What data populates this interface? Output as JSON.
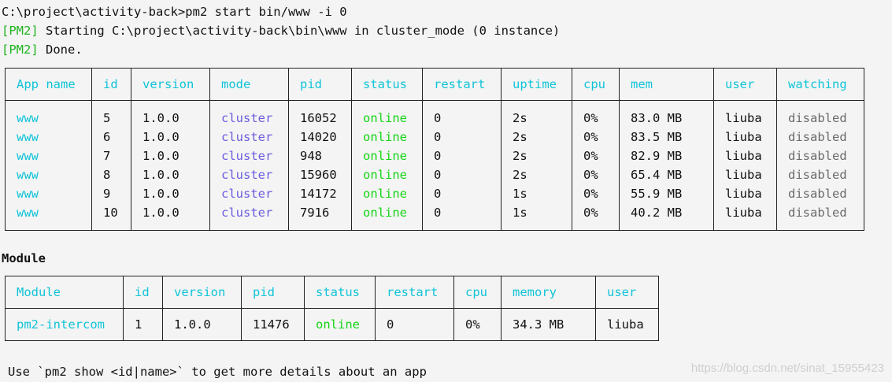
{
  "command": {
    "prompt": "C:\\project\\activity-back>",
    "text": "pm2 start bin/www -i 0"
  },
  "log": [
    {
      "tag": "[PM2]",
      "text": " Starting C:\\project\\activity-back\\bin\\www in cluster_mode (0 instance)"
    },
    {
      "tag": "[PM2]",
      "text": " Done."
    }
  ],
  "apps_table": {
    "headers": [
      "App name",
      "id",
      "version",
      "mode",
      "pid",
      "status",
      "restart",
      "uptime",
      "cpu",
      "mem",
      "user",
      "watching"
    ],
    "rows": [
      {
        "name": "www",
        "id": "5",
        "version": "1.0.0",
        "mode": "cluster",
        "pid": "16052",
        "status": "online",
        "restart": "0",
        "uptime": "2s",
        "cpu": "0%",
        "mem": "83.0 MB",
        "user": "liuba",
        "watching": "disabled"
      },
      {
        "name": "www",
        "id": "6",
        "version": "1.0.0",
        "mode": "cluster",
        "pid": "14020",
        "status": "online",
        "restart": "0",
        "uptime": "2s",
        "cpu": "0%",
        "mem": "83.5 MB",
        "user": "liuba",
        "watching": "disabled"
      },
      {
        "name": "www",
        "id": "7",
        "version": "1.0.0",
        "mode": "cluster",
        "pid": "948",
        "status": "online",
        "restart": "0",
        "uptime": "2s",
        "cpu": "0%",
        "mem": "82.9 MB",
        "user": "liuba",
        "watching": "disabled"
      },
      {
        "name": "www",
        "id": "8",
        "version": "1.0.0",
        "mode": "cluster",
        "pid": "15960",
        "status": "online",
        "restart": "0",
        "uptime": "2s",
        "cpu": "0%",
        "mem": "65.4 MB",
        "user": "liuba",
        "watching": "disabled"
      },
      {
        "name": "www",
        "id": "9",
        "version": "1.0.0",
        "mode": "cluster",
        "pid": "14172",
        "status": "online",
        "restart": "0",
        "uptime": "1s",
        "cpu": "0%",
        "mem": "55.9 MB",
        "user": "liuba",
        "watching": "disabled"
      },
      {
        "name": "www",
        "id": "10",
        "version": "1.0.0",
        "mode": "cluster",
        "pid": "7916",
        "status": "online",
        "restart": "0",
        "uptime": "1s",
        "cpu": "0%",
        "mem": "40.2 MB",
        "user": "liuba",
        "watching": "disabled"
      }
    ]
  },
  "module_section": {
    "title": "Module",
    "headers": [
      "Module",
      "id",
      "version",
      "pid",
      "status",
      "restart",
      "cpu",
      "memory",
      "user"
    ],
    "rows": [
      {
        "name": "pm2-intercom",
        "id": "1",
        "version": "1.0.0",
        "pid": "11476",
        "status": "online",
        "restart": "0",
        "cpu": "0%",
        "memory": "34.3 MB",
        "user": "liuba"
      }
    ]
  },
  "footer": "Use `pm2 show <id|name>` to get more details about an app",
  "watermark": "https://blog.csdn.net/sinat_15955423",
  "colors": {
    "tag": "#1fb41f",
    "header": "#10c4d8",
    "mode": "#6a5de0",
    "online": "#15d515",
    "disabled": "#6b6b6b",
    "background": "#f4f4f4"
  }
}
